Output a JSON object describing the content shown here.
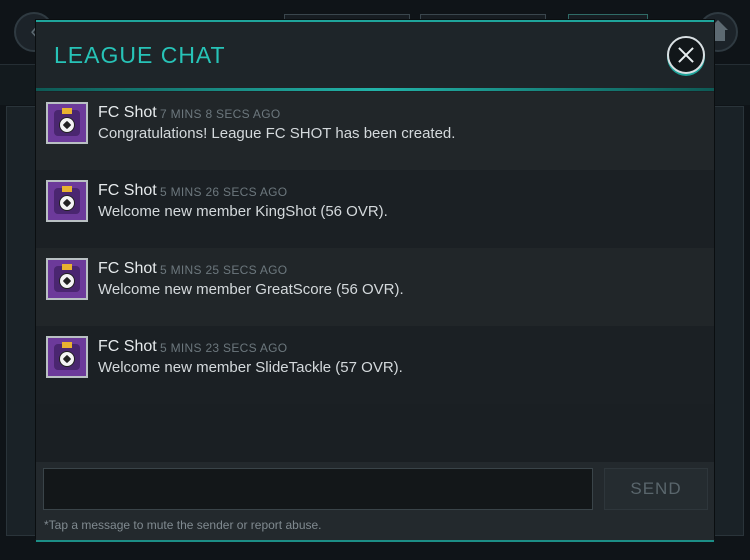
{
  "modal": {
    "title": "LEAGUE CHAT",
    "accent_color": "#27c3b7"
  },
  "messages": [
    {
      "sender": "FC Shot",
      "time": "7 MINS 8 SECS AGO",
      "text": "Congratulations! League FC SHOT has been created.",
      "avatar_icon": "club-crest-icon"
    },
    {
      "sender": "FC Shot",
      "time": "5 MINS 26 SECS AGO",
      "text": "Welcome new member KingShot (56 OVR).",
      "avatar_icon": "club-crest-icon"
    },
    {
      "sender": "FC Shot",
      "time": "5 MINS 25 SECS AGO",
      "text": "Welcome new member GreatScore (56 OVR).",
      "avatar_icon": "club-crest-icon"
    },
    {
      "sender": "FC Shot",
      "time": "5 MINS 23 SECS AGO",
      "text": "Welcome new member SlideTackle (57 OVR).",
      "avatar_icon": "club-crest-icon"
    }
  ],
  "composer": {
    "input_value": "",
    "send_label": "SEND",
    "hint": "*Tap a message to mute the sender or report abuse."
  }
}
